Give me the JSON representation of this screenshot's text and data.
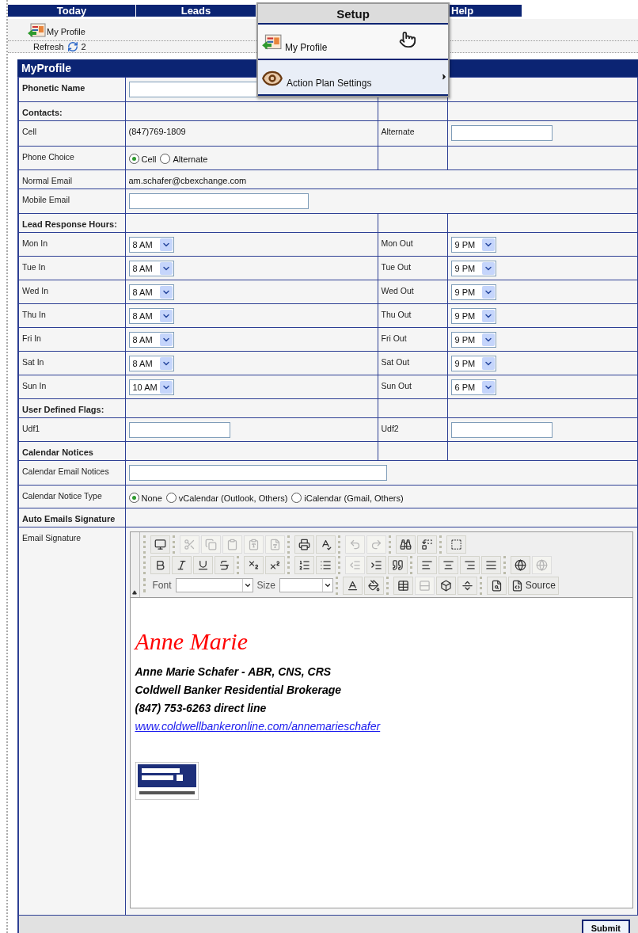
{
  "nav": {
    "tabs": [
      {
        "label": "Today"
      },
      {
        "label": "Leads"
      },
      {
        "label": "Help"
      }
    ]
  },
  "menu": {
    "title": "Setup",
    "items": [
      {
        "label": "My Profile",
        "kind": "profile",
        "submenu": false,
        "hovered": true
      },
      {
        "label": "Action Plan Settings",
        "kind": "eye",
        "submenu": true,
        "hovered": false
      }
    ]
  },
  "toolbar": {
    "link": "My Profile",
    "refresh": "Refresh",
    "count": "2"
  },
  "panel": {
    "title": "MyProfile",
    "rows": [
      {
        "kind": "pair",
        "label": "Phonetic Name",
        "emphasis": true,
        "value": {
          "kind": "input"
        }
      },
      {
        "kind": "section",
        "label": "Contacts:",
        "merged": false
      },
      {
        "kind": "pair",
        "label": "Cell",
        "emphasis": false,
        "value": {
          "kind": "text",
          "text": "(847)769-1809"
        },
        "label2": "Alternate",
        "value2": {
          "kind": "input"
        }
      },
      {
        "kind": "pair",
        "label": "Phone Choice",
        "emphasis": false,
        "value": {
          "kind": "radios",
          "options": [
            {
              "label": "Cell",
              "selected": true
            },
            {
              "label": "Alternate",
              "selected": false
            }
          ]
        }
      },
      {
        "kind": "wide",
        "label": "Normal Email",
        "value": {
          "kind": "text",
          "text": "am.schafer@cbexchange.com"
        }
      },
      {
        "kind": "wide",
        "label": "Mobile Email",
        "value": {
          "kind": "input"
        }
      },
      {
        "kind": "section",
        "label": "Lead Response Hours:",
        "merged": false
      },
      {
        "kind": "pair",
        "label": "Mon In",
        "emphasis": false,
        "value": {
          "kind": "select",
          "text": "8 AM"
        },
        "label2": "Mon Out",
        "value2": {
          "kind": "select",
          "text": "9 PM"
        }
      },
      {
        "kind": "pair",
        "label": "Tue In",
        "emphasis": false,
        "value": {
          "kind": "select",
          "text": "8 AM"
        },
        "label2": "Tue Out",
        "value2": {
          "kind": "select",
          "text": "9 PM"
        }
      },
      {
        "kind": "pair",
        "label": "Wed In",
        "emphasis": false,
        "value": {
          "kind": "select",
          "text": "8 AM"
        },
        "label2": "Wed Out",
        "value2": {
          "kind": "select",
          "text": "9 PM"
        }
      },
      {
        "kind": "pair",
        "label": "Thu In",
        "emphasis": false,
        "value": {
          "kind": "select",
          "text": "8 AM"
        },
        "label2": "Thu Out",
        "value2": {
          "kind": "select",
          "text": "9 PM"
        }
      },
      {
        "kind": "pair",
        "label": "Fri In",
        "emphasis": false,
        "value": {
          "kind": "select",
          "text": "8 AM"
        },
        "label2": "Fri Out",
        "value2": {
          "kind": "select",
          "text": "9 PM"
        }
      },
      {
        "kind": "pair",
        "label": "Sat In",
        "emphasis": false,
        "value": {
          "kind": "select",
          "text": "8 AM"
        },
        "label2": "Sat Out",
        "value2": {
          "kind": "select",
          "text": "9 PM"
        }
      },
      {
        "kind": "pair",
        "label": "Sun In",
        "emphasis": false,
        "value": {
          "kind": "select",
          "text": "10 AM"
        },
        "label2": "Sun Out",
        "value2": {
          "kind": "select",
          "text": "6 PM"
        }
      },
      {
        "kind": "section",
        "label": "User Defined Flags:",
        "merged": false
      },
      {
        "kind": "pair",
        "label": "Udf1",
        "emphasis": false,
        "value": {
          "kind": "input"
        },
        "label2": "Udf2",
        "value2": {
          "kind": "input"
        }
      },
      {
        "kind": "section",
        "label": "Calendar Notices",
        "merged": false
      },
      {
        "kind": "wide",
        "label": "Calendar Email Notices",
        "value": {
          "kind": "input"
        }
      },
      {
        "kind": "wide",
        "label": "Calendar Notice Type",
        "value": {
          "kind": "radios",
          "options": [
            {
              "label": "None",
              "selected": true
            },
            {
              "label": "vCalendar (Outlook, Others)",
              "selected": false
            },
            {
              "label": "iCalendar (Gmail, Others)",
              "selected": false
            }
          ]
        }
      },
      {
        "kind": "section",
        "label": "Auto Emails Signature",
        "merged": true
      },
      {
        "kind": "editor",
        "label": "Email Signature"
      }
    ]
  },
  "editor": {
    "rows": [
      [
        [
          {
            "kind": "preview",
            "disabled": false
          }
        ],
        [
          {
            "kind": "cut",
            "disabled": true
          },
          {
            "kind": "copy",
            "disabled": true
          },
          {
            "kind": "paste",
            "disabled": true
          },
          {
            "kind": "pastetext",
            "disabled": true
          },
          {
            "kind": "pasteword",
            "disabled": true
          }
        ],
        [
          {
            "kind": "print",
            "disabled": false
          },
          {
            "kind": "spell",
            "disabled": false
          }
        ],
        [
          {
            "kind": "undo",
            "disabled": true
          },
          {
            "kind": "redo",
            "disabled": true
          }
        ],
        [
          {
            "kind": "find",
            "disabled": false
          },
          {
            "kind": "replace",
            "disabled": false
          }
        ],
        [
          {
            "kind": "selectall",
            "disabled": false
          }
        ]
      ],
      [
        [
          {
            "kind": "bold",
            "disabled": false
          },
          {
            "kind": "italic",
            "disabled": false
          },
          {
            "kind": "underline",
            "disabled": false
          },
          {
            "kind": "strike",
            "disabled": false
          }
        ],
        [
          {
            "kind": "sub",
            "disabled": false
          },
          {
            "kind": "sup",
            "disabled": false
          }
        ],
        [
          {
            "kind": "ol",
            "disabled": false
          },
          {
            "kind": "ul",
            "disabled": false
          }
        ],
        [
          {
            "kind": "outdent",
            "disabled": true
          },
          {
            "kind": "indent",
            "disabled": false
          },
          {
            "kind": "quote",
            "disabled": false
          }
        ],
        [
          {
            "kind": "left",
            "disabled": false
          },
          {
            "kind": "center",
            "disabled": false
          },
          {
            "kind": "right",
            "disabled": false
          },
          {
            "kind": "justify",
            "disabled": false
          }
        ],
        [
          {
            "kind": "link",
            "disabled": false
          },
          {
            "kind": "unlink",
            "disabled": true
          }
        ]
      ],
      [
        [
          {
            "kind": "label",
            "text": "Font"
          },
          {
            "kind": "fontcombo"
          },
          {
            "kind": "label",
            "text": "Size"
          },
          {
            "kind": "sizecombo"
          }
        ],
        [
          {
            "kind": "textcolor",
            "disabled": false
          },
          {
            "kind": "bgcolor",
            "disabled": false
          }
        ],
        [
          {
            "kind": "table",
            "disabled": false
          },
          {
            "kind": "rule",
            "disabled": true
          },
          {
            "kind": "special",
            "disabled": false
          },
          {
            "kind": "pagebreak",
            "disabled": false
          }
        ],
        [
          {
            "kind": "zoom",
            "disabled": false
          },
          {
            "kind": "source",
            "text": "Source",
            "disabled": false
          }
        ]
      ]
    ],
    "signature": {
      "name": "Anne Marie",
      "lines": [
        "Anne Marie Schafer - ABR, CNS, CRS",
        "Coldwell Banker Residential Brokerage",
        "(847) 753-6263 direct line"
      ],
      "link": "www.coldwellbankeronline.com/annemarieschafer",
      "logo": {
        "kind": "picture"
      }
    }
  },
  "footer": {
    "submit": "Submit"
  }
}
